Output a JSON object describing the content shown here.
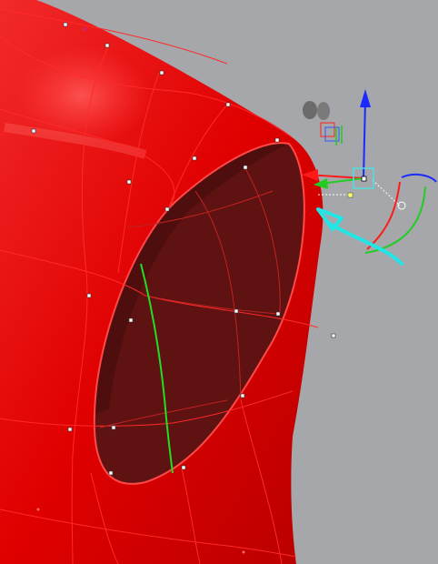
{
  "viewport": {
    "background_color": "#a5a7ab",
    "surface_color": "#e00000",
    "surface_highlight_color": "#ff3a3a",
    "opening_color": "#5e1212",
    "isocurve_color": "#ff2a2a",
    "selected_curve_color": "#22dd22",
    "annotation_color": "#22e5e5"
  },
  "gizmo": {
    "axes": [
      "x-axis",
      "y-axis",
      "z-axis"
    ],
    "axis_colors": {
      "x": "#ff1a1a",
      "y": "#22cc22",
      "z": "#1a2aff"
    },
    "center_handle_color": "#4fe0e0"
  }
}
